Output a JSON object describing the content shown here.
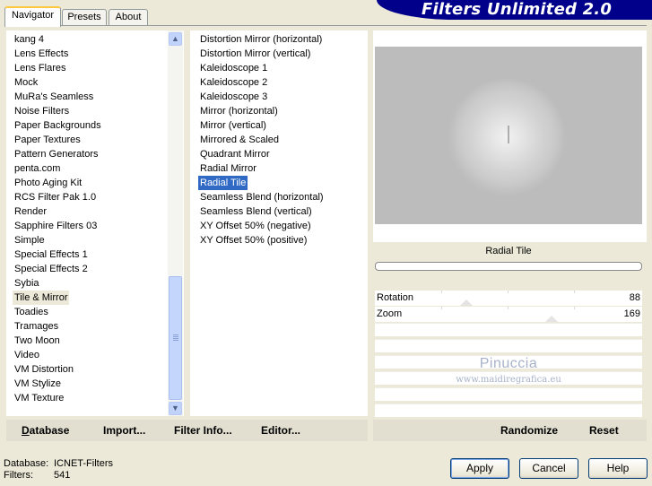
{
  "tabs": [
    "Navigator",
    "Presets",
    "About"
  ],
  "banner": "Filters Unlimited 2.0",
  "categories": [
    "kang 4",
    "Lens Effects",
    "Lens Flares",
    "Mock",
    "MuRa's Seamless",
    "Noise Filters",
    "Paper Backgrounds",
    "Paper Textures",
    "Pattern Generators",
    "penta.com",
    "Photo Aging Kit",
    "RCS Filter Pak 1.0",
    "Render",
    "Sapphire Filters 03",
    "Simple",
    "Special Effects 1",
    "Special Effects 2",
    "Sybia",
    "Tile & Mirror",
    "Toadies",
    "Tramages",
    "Two Moon",
    "Video",
    "VM Distortion",
    "VM Stylize",
    "VM Texture"
  ],
  "selected_category": "Tile & Mirror",
  "filters": [
    "Distortion Mirror (horizontal)",
    "Distortion Mirror (vertical)",
    "Kaleidoscope 1",
    "Kaleidoscope 2",
    "Kaleidoscope 3",
    "Mirror (horizontal)",
    "Mirror (vertical)",
    "Mirrored & Scaled",
    "Quadrant Mirror",
    "Radial Mirror",
    "Radial Tile",
    "Seamless Blend (horizontal)",
    "Seamless Blend (vertical)",
    "XY Offset 50% (negative)",
    "XY Offset 50% (positive)"
  ],
  "selected_filter": "Radial Tile",
  "preview": {
    "filter_name": "Radial Tile"
  },
  "params": [
    {
      "name": "Rotation",
      "value": "88"
    },
    {
      "name": "Zoom",
      "value": "169"
    }
  ],
  "watermark": {
    "line1": "Pinuccia",
    "line2": "www.maidiregrafica.eu"
  },
  "left_actions": {
    "database": "Database",
    "import": "Import...",
    "filter_info": "Filter Info...",
    "editor": "Editor..."
  },
  "right_actions": {
    "randomize": "Randomize",
    "reset": "Reset"
  },
  "footer": {
    "database_label": "Database:",
    "database_value": "ICNET-Filters",
    "filters_label": "Filters:",
    "filters_value": "541"
  },
  "buttons": {
    "apply": "Apply",
    "cancel": "Cancel",
    "help": "Help"
  },
  "colors": {
    "selection": "#316ac5",
    "banner": "#00008b",
    "tab_highlight": "#ffc83c"
  }
}
